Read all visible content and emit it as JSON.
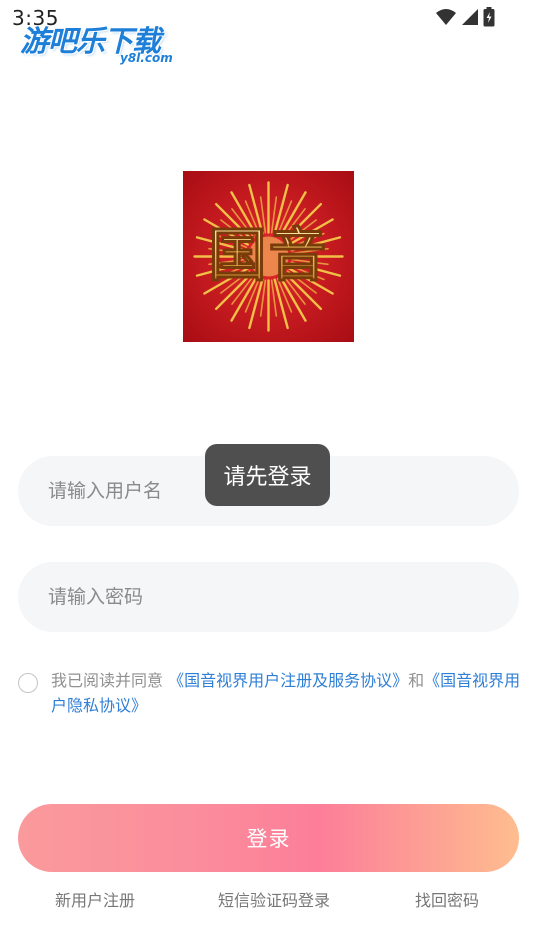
{
  "status_bar": {
    "time": "3:35"
  },
  "watermark": {
    "main": "游吧乐下载",
    "sub": "y8l.com"
  },
  "logo": {
    "text": "国音",
    "colors": {
      "background": "#c0161c",
      "rays": "#f3c94a",
      "text": "#f0c060"
    }
  },
  "form": {
    "username_placeholder": "请输入用户名",
    "password_placeholder": "请输入密码"
  },
  "toast": {
    "message": "请先登录"
  },
  "agreement": {
    "prefix": "我已阅读并同意 ",
    "link_service": "《国音视界用户注册及服务协议》",
    "conjunction": "和",
    "link_privacy": "《国音视界用户隐私协议》"
  },
  "login_button": {
    "label": "登录"
  },
  "bottom_links": {
    "register": "新用户注册",
    "sms_login": "短信验证码登录",
    "forgot_password": "找回密码"
  },
  "colors": {
    "accent_link": "#2f7fd6",
    "button_gradient_start": "#fa9a9c",
    "button_gradient_end": "#ffbd8f",
    "input_background": "#f5f6f8"
  }
}
